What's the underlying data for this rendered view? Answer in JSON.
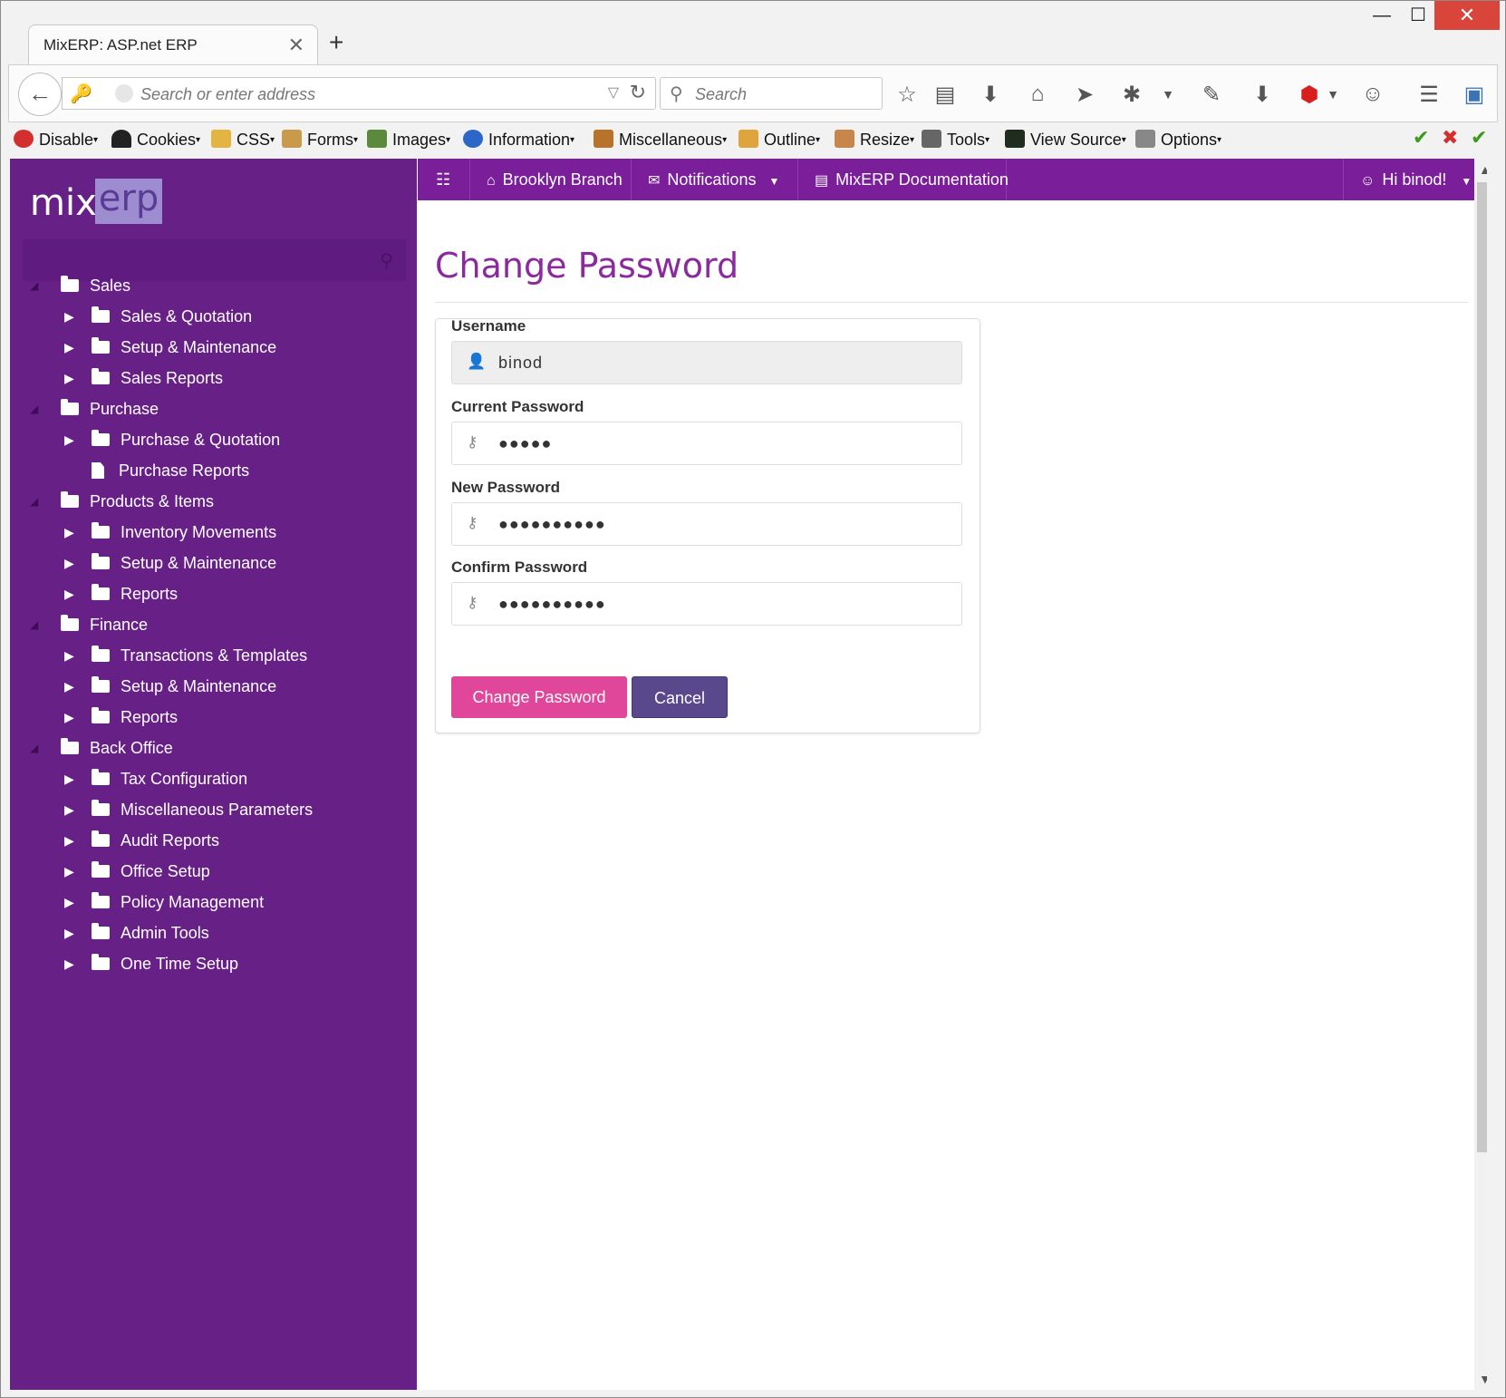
{
  "browser": {
    "tab_title": "MixERP: ASP.net ERP",
    "tab_close": "✕",
    "new_tab": "+",
    "window_min": "—",
    "window_max": "☐",
    "window_close": "✕",
    "url_placeholder": "Search or enter address",
    "search_placeholder": "Search"
  },
  "dev_toolbar": {
    "items": [
      "Disable",
      "Cookies",
      "CSS",
      "Forms",
      "Images",
      "Information",
      "Miscellaneous",
      "Outline",
      "Resize",
      "Tools",
      "View Source",
      "Options"
    ]
  },
  "sidebar": {
    "logo_left": "mix",
    "logo_right": "erp",
    "groups": [
      {
        "label": "Sales",
        "children": [
          "Sales & Quotation",
          "Setup & Maintenance",
          "Sales Reports"
        ]
      },
      {
        "label": "Purchase",
        "children": [
          "Purchase & Quotation",
          "Purchase Reports"
        ]
      },
      {
        "label": "Products & Items",
        "children": [
          "Inventory Movements",
          "Setup & Maintenance",
          "Reports"
        ]
      },
      {
        "label": "Finance",
        "children": [
          "Transactions & Templates",
          "Setup & Maintenance",
          "Reports"
        ]
      },
      {
        "label": "Back Office",
        "children": [
          "Tax Configuration",
          "Miscellaneous Parameters",
          "Audit Reports",
          "Office Setup",
          "Policy Management",
          "Admin Tools",
          "One Time Setup"
        ]
      }
    ]
  },
  "appnav": {
    "branch": "Brooklyn Branch",
    "notifications": "Notifications",
    "documentation": "MixERP Documentation",
    "user": "Hi binod!"
  },
  "form": {
    "title": "Change Password",
    "username_label": "Username",
    "username_value": "binod",
    "current_label": "Current Password",
    "current_value": "●●●●●",
    "new_label": "New Password",
    "new_value": "●●●●●●●●●●",
    "confirm_label": "Confirm Password",
    "confirm_value": "●●●●●●●●●●",
    "submit_label": "Change Password",
    "cancel_label": "Cancel"
  },
  "colors": {
    "sidebar": "#672186",
    "appnav": "#7a1e9a",
    "title": "#8b2a9e",
    "primary_button": "#e0479a",
    "cancel_button": "#59498c"
  }
}
